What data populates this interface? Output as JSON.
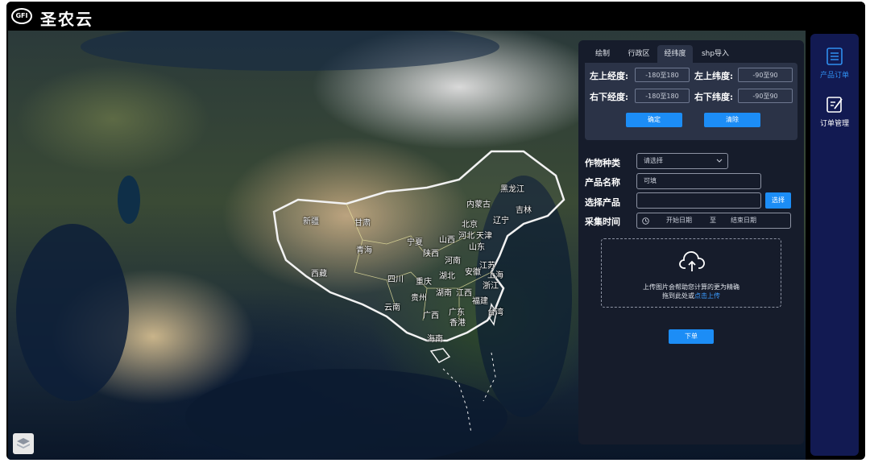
{
  "brand": {
    "logo_text": "GFI",
    "name": "圣农云"
  },
  "map": {
    "provinces": [
      "黑龙江",
      "吉林",
      "辽宁",
      "内蒙古",
      "北京",
      "河北",
      "天津",
      "山西",
      "山东",
      "新疆",
      "甘肃",
      "宁夏",
      "青海",
      "陕西",
      "河南",
      "江苏",
      "西藏",
      "四川",
      "重庆",
      "湖北",
      "安徽",
      "上海",
      "浙江",
      "贵州",
      "湖南",
      "江西",
      "福建",
      "云南",
      "广西",
      "广东",
      "台湾",
      "香港",
      "海南"
    ]
  },
  "panel": {
    "tabs": [
      "绘制",
      "行政区",
      "经纬度",
      "shp导入"
    ],
    "active_tab": "经纬度",
    "coords": {
      "top_left_lng_label": "左上经度:",
      "top_left_lat_label": "左上纬度:",
      "bottom_right_lng_label": "右下经度:",
      "bottom_right_lat_label": "右下纬度:",
      "lng_placeholder": "-180至180",
      "lat_placeholder": "-90至90",
      "confirm_label": "确定",
      "clear_label": "清除"
    },
    "form": {
      "crop_label": "作物种类",
      "crop_value": "请选择",
      "product_name_label": "产品名称",
      "product_name_placeholder": "可填",
      "select_product_label": "选择产品",
      "select_button": "选择",
      "time_label": "采集时间",
      "start_date": "开始日期",
      "to": "至",
      "end_date": "结束日期"
    },
    "upload": {
      "line1": "上传图片会帮助您计算的更为精确",
      "line2_prefix": "拖到此处或",
      "line2_link": "点击上传"
    },
    "submit_label": "下单"
  },
  "sidebar": {
    "items": [
      {
        "label": "产品订单",
        "icon": "document-list-icon",
        "active": true
      },
      {
        "label": "订单管理",
        "icon": "edit-note-icon",
        "active": false
      }
    ]
  },
  "colors": {
    "accent": "#1c8df6",
    "panel_bg": "#161c2b",
    "sidebar_bg": "#121a52"
  }
}
